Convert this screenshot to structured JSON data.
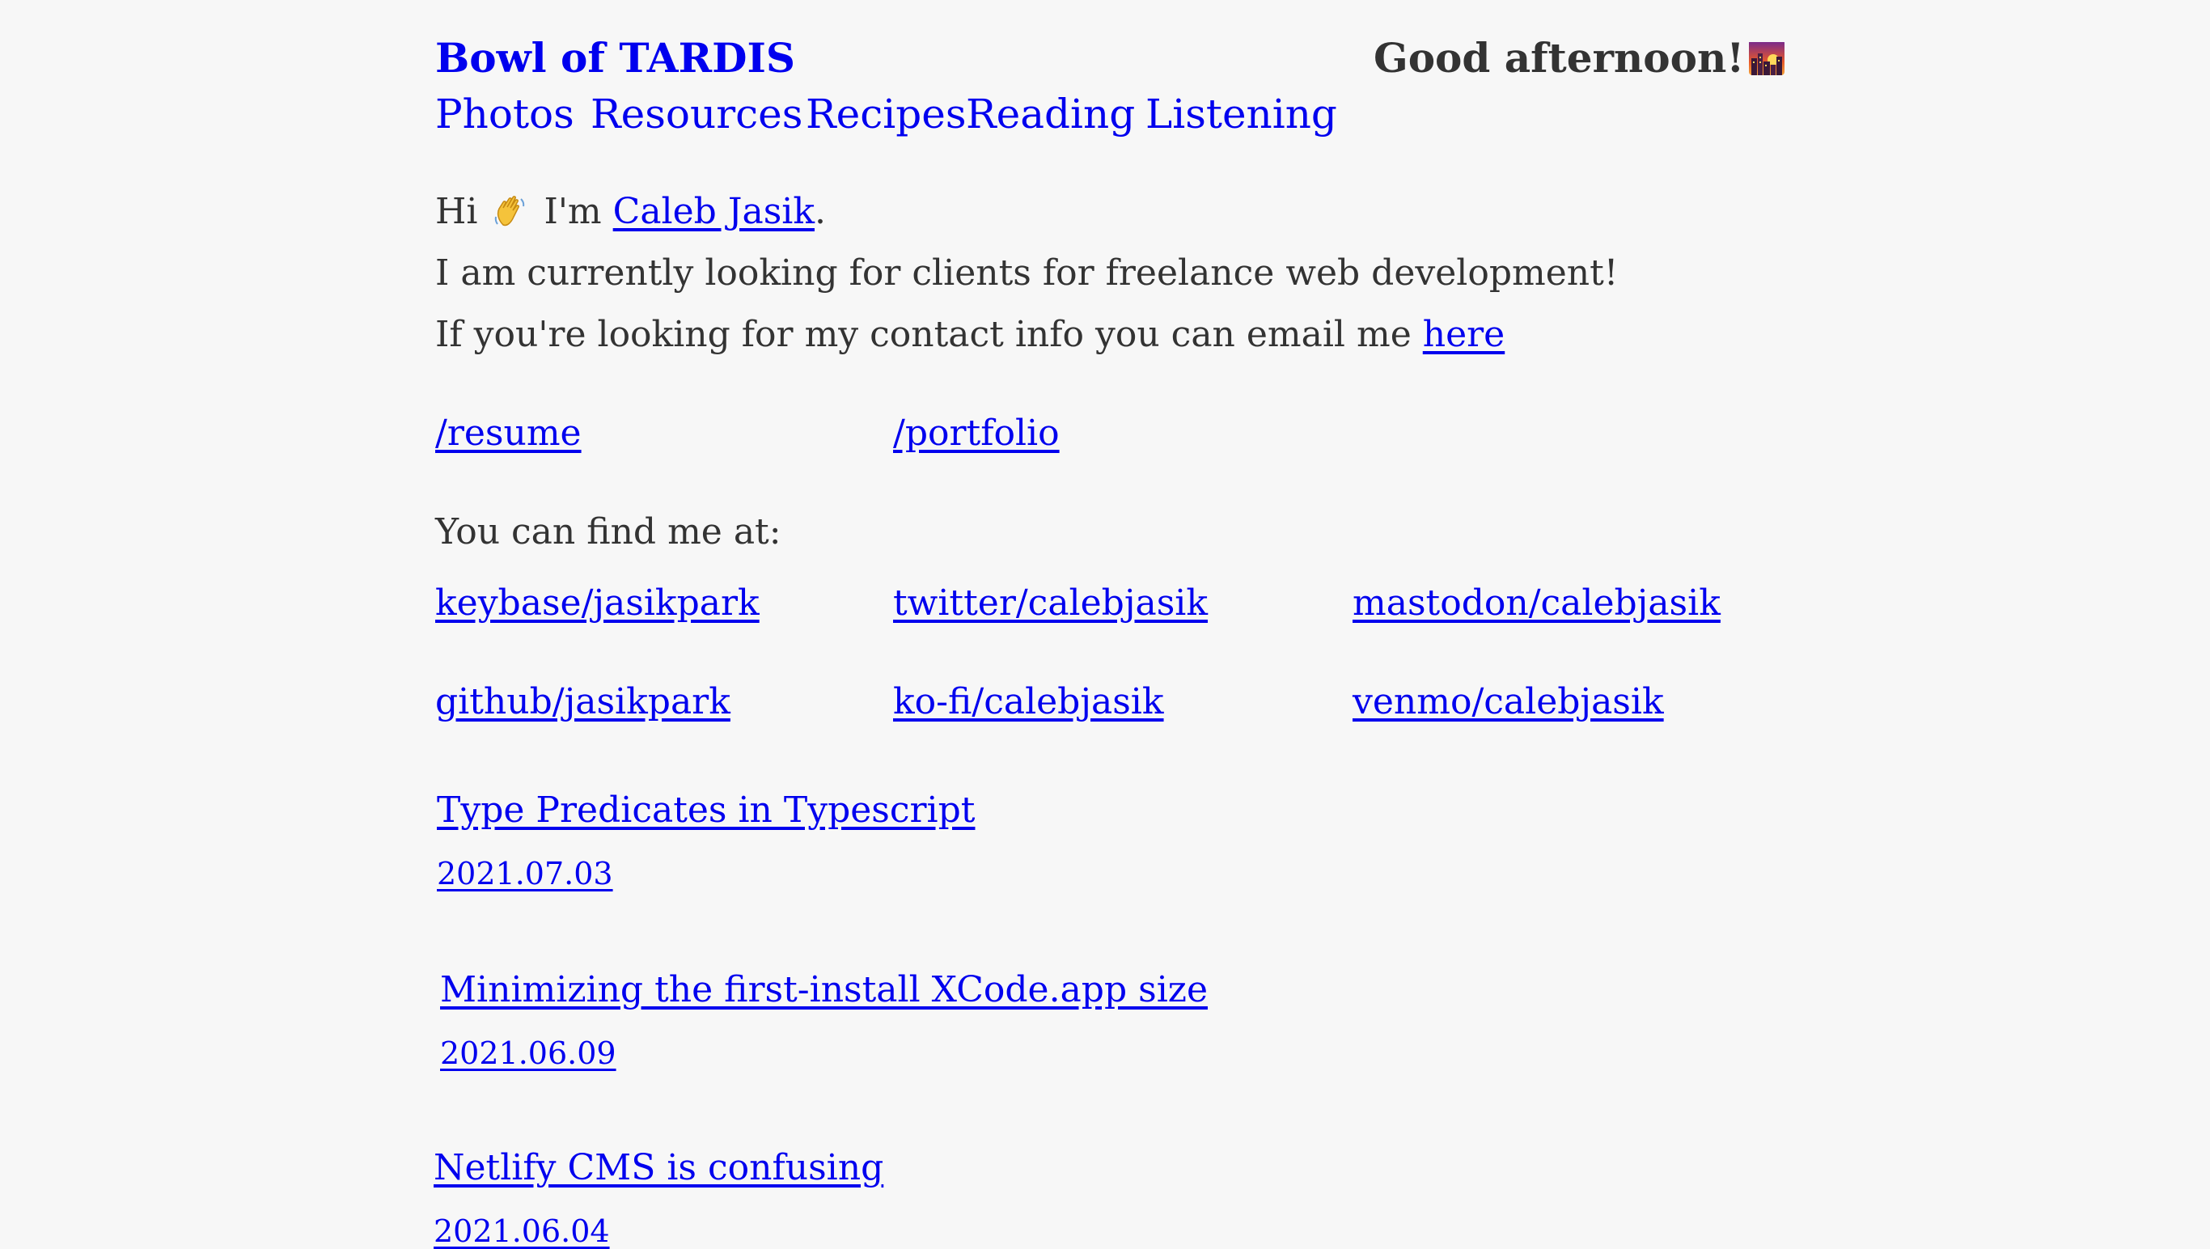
{
  "header": {
    "site_title": "Bowl of TARDIS",
    "greeting": "Good afternoon!",
    "greeting_icon": "sunset-cityscape-icon"
  },
  "nav": {
    "items": [
      {
        "label": "Photos"
      },
      {
        "label": "Resources"
      },
      {
        "label": "Recipes"
      },
      {
        "label": "Reading"
      },
      {
        "label": "Listening"
      }
    ]
  },
  "intro": {
    "hi_prefix": "Hi",
    "wave_icon": "waving-hand-icon",
    "im_text": "I'm",
    "name_link": "Caleb Jasik",
    "period": ".",
    "line2": "I am currently looking for clients for freelance web development!",
    "line3_prefix": "If you're looking for my contact info you can email me",
    "line3_link": "here"
  },
  "pages": {
    "resume": "/resume",
    "portfolio": "/portfolio"
  },
  "social": {
    "heading": "You can find me at:",
    "links": [
      {
        "label": "keybase/jasikpark"
      },
      {
        "label": "twitter/calebjasik"
      },
      {
        "label": "mastodon/calebjasik"
      },
      {
        "label": "github/jasikpark"
      },
      {
        "label": "ko-fi/calebjasik"
      },
      {
        "label": "venmo/calebjasik"
      }
    ]
  },
  "posts": [
    {
      "title": "Type Predicates in Typescript",
      "date": "2021.07.03"
    },
    {
      "title": "Minimizing the first-install XCode.app size",
      "date": "2021.06.09"
    },
    {
      "title": "Netlify CMS is confusing",
      "date": "2021.06.04"
    }
  ],
  "colors": {
    "background": "#f7f7f7",
    "link": "#0000ee",
    "text": "#333333"
  }
}
